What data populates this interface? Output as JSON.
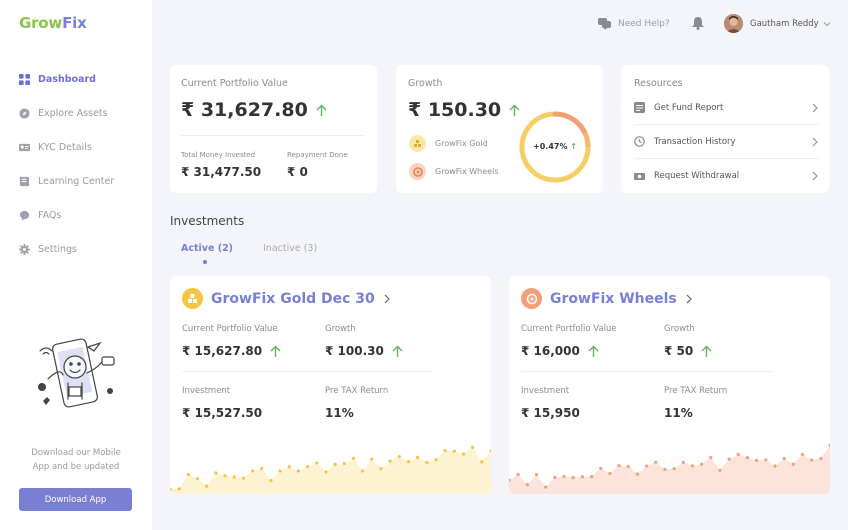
{
  "brand": {
    "part1": "Grow",
    "part2": "Fix"
  },
  "header": {
    "help": "Need Help?",
    "user": "Gautham Reddy"
  },
  "sidebar": {
    "items": [
      {
        "label": "Dashboard",
        "icon": "grid-icon",
        "active": true
      },
      {
        "label": "Explore Assets",
        "icon": "compass-icon"
      },
      {
        "label": "KYC Details",
        "icon": "id-card-icon"
      },
      {
        "label": "Learning Center",
        "icon": "book-icon"
      },
      {
        "label": "FAQs",
        "icon": "chat-icon"
      },
      {
        "label": "Settings",
        "icon": "gear-icon"
      }
    ],
    "promo_text": "Download our Mobile App and be updated",
    "download_button": "Download App"
  },
  "portfolio": {
    "title": "Current Portfolio Value",
    "value": "₹ 31,627.80",
    "invested_label": "Total Money Invested",
    "invested_value": "₹ 31,477.50",
    "repayment_label": "Repayment Done",
    "repayment_value": "₹ 0"
  },
  "growth": {
    "title": "Growth",
    "value": "₹ 150.30",
    "percent": "+0.47%",
    "legend": [
      {
        "label": "GrowFix Gold",
        "color": "#f5c542"
      },
      {
        "label": "GrowFix Wheels",
        "color": "#f29f7a"
      }
    ]
  },
  "resources": {
    "title": "Resources",
    "items": [
      "Get Fund Report",
      "Transaction History",
      "Request Withdrawal"
    ]
  },
  "investments": {
    "title": "Investments",
    "tabs": [
      "Active (2)",
      "Inactive (3)"
    ],
    "cards": [
      {
        "name": "GrowFix Gold Dec 30",
        "color": "#f5c542",
        "cpv_label": "Current Portfolio Value",
        "cpv": "₹ 15,627.80",
        "growth_label": "Growth",
        "growth": "₹ 100.30",
        "inv_label": "Investment",
        "inv": "₹ 15,527.50",
        "ret_label": "Pre TAX Return",
        "ret": "11%"
      },
      {
        "name": "GrowFix Wheels",
        "color": "#f29f7a",
        "cpv_label": "Current Portfolio Value",
        "cpv": "₹ 16,000",
        "growth_label": "Growth",
        "growth": "₹ 50",
        "inv_label": "Investment",
        "inv": "₹ 15,950",
        "ret_label": "Pre TAX Return",
        "ret": "11%"
      }
    ]
  },
  "colors": {
    "accent": "#7a7fd6",
    "up": "#5cb85c",
    "gold": "#f5c542",
    "wheels": "#f29f7a"
  }
}
